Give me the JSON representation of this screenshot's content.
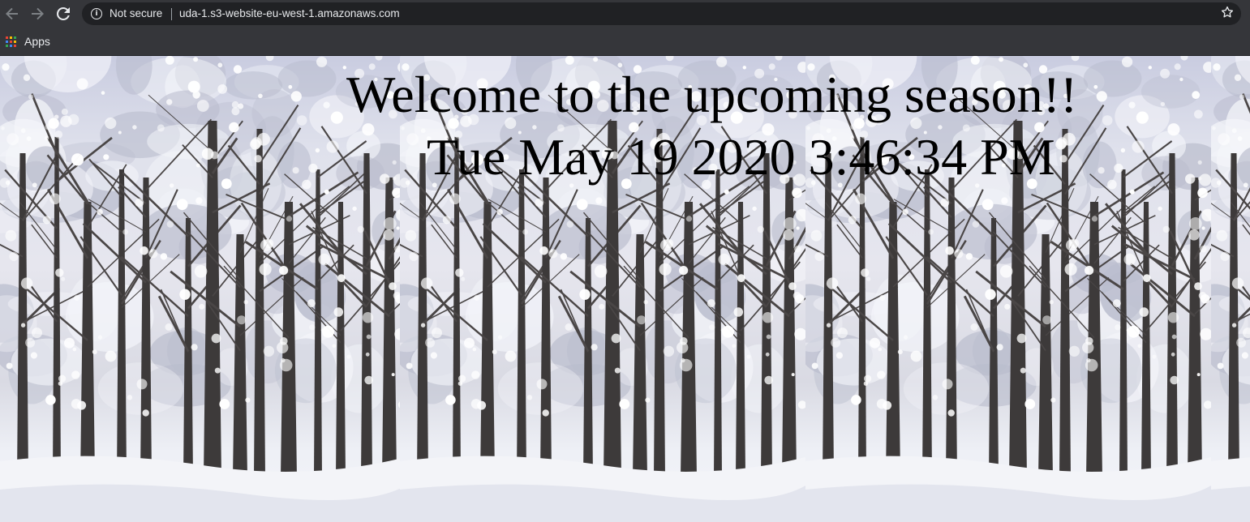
{
  "browser": {
    "nav": {
      "back_icon": "arrow-left-icon",
      "forward_icon": "arrow-right-icon",
      "reload_icon": "reload-icon"
    },
    "omnibox": {
      "security_icon": "info-icon",
      "security_label": "Not secure",
      "url": "uda-1.s3-website-eu-west-1.amazonaws.com",
      "bookmark_icon": "star-icon"
    },
    "bookmarks_bar": {
      "apps_label": "Apps",
      "apps_icon": "apps-grid-icon"
    },
    "colors": {
      "chrome": "#35363a",
      "omnibox": "#202124",
      "text": "#e8eaed"
    }
  },
  "page": {
    "heading": "Welcome to the upcoming season!!",
    "datetime": "Tue May 19 2020 3:46:34 PM",
    "background": "snowy-forest-image-tiled",
    "text_color": "#000000"
  }
}
